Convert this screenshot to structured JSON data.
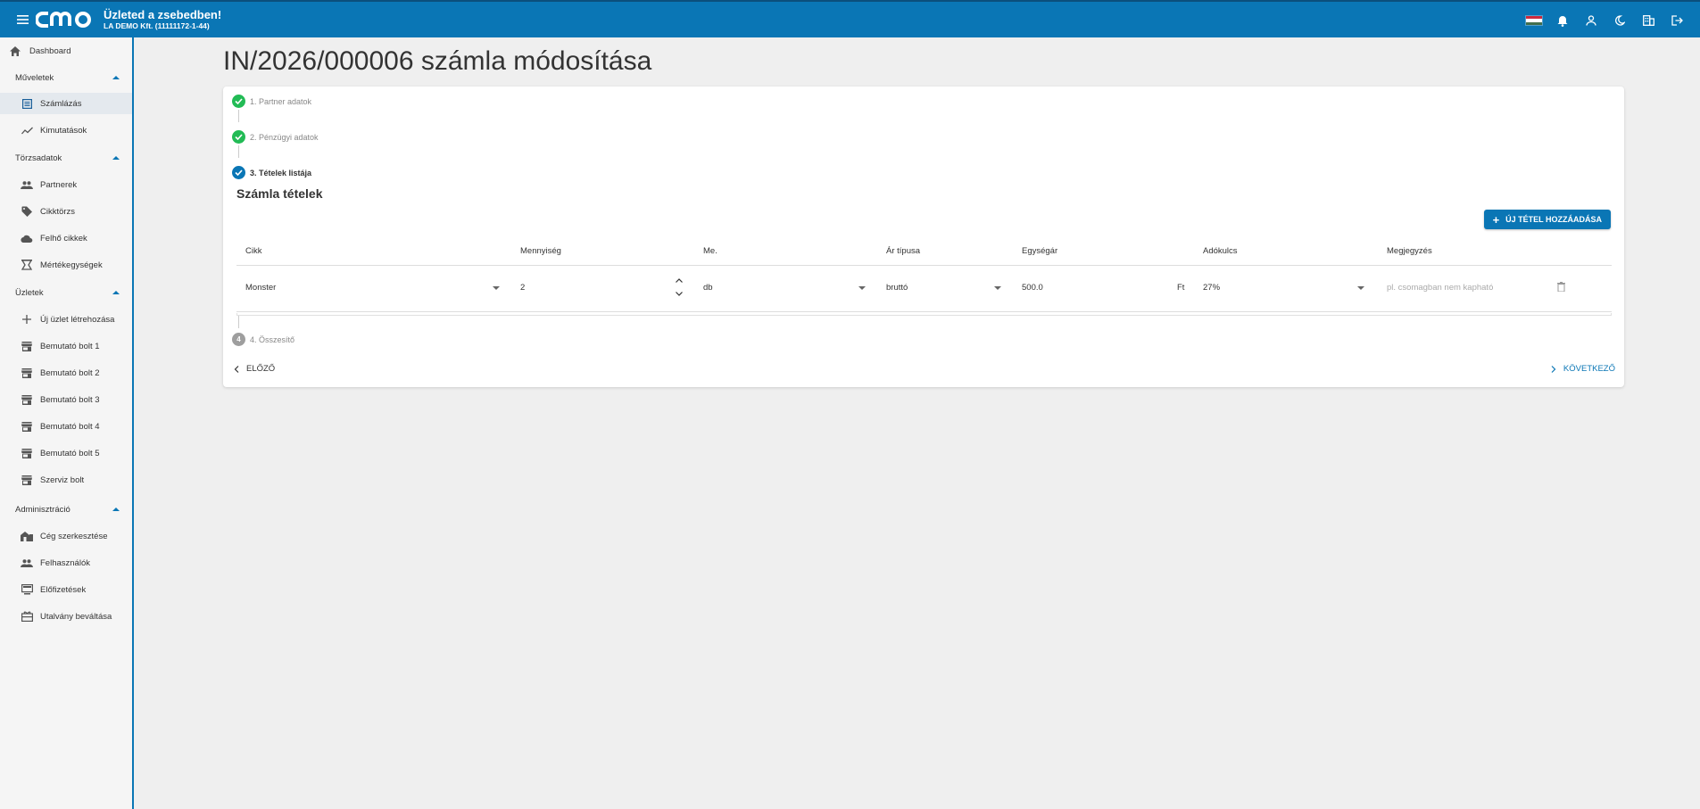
{
  "header": {
    "title": "Üzleted a zsebedben!",
    "company": "LA DEMO Kft. (11111172-1-44)",
    "logo_text": "cmo",
    "flag_colors": [
      "#cd2a3e",
      "#ffffff",
      "#436f4d"
    ]
  },
  "sidebar": {
    "dashboard": "Dashboard",
    "sections": [
      {
        "label": "Műveletek",
        "items": [
          {
            "label": "Számlázás",
            "icon": "list-icon",
            "active": true
          },
          {
            "label": "Kimutatások",
            "icon": "trending-icon"
          }
        ]
      },
      {
        "label": "Törzsadatok",
        "items": [
          {
            "label": "Partnerek",
            "icon": "people-icon"
          },
          {
            "label": "Cikktörzs",
            "icon": "tag-icon"
          },
          {
            "label": "Felhő cikkek",
            "icon": "cloud-icon"
          },
          {
            "label": "Mértékegységek",
            "icon": "scale-icon"
          }
        ]
      },
      {
        "label": "Üzletek",
        "items": [
          {
            "label": "Új üzlet létrehozása",
            "icon": "plus-icon"
          },
          {
            "label": "Bemutató bolt 1",
            "icon": "store-icon"
          },
          {
            "label": "Bemutató bolt 2",
            "icon": "store-icon"
          },
          {
            "label": "Bemutató bolt 3",
            "icon": "store-icon"
          },
          {
            "label": "Bemutató bolt 4",
            "icon": "store-icon"
          },
          {
            "label": "Bemutató bolt 5",
            "icon": "store-icon"
          },
          {
            "label": "Szerviz bolt",
            "icon": "store-icon"
          }
        ]
      },
      {
        "label": "Adminisztráció",
        "items": [
          {
            "label": "Cég szerkesztése",
            "icon": "company-icon"
          },
          {
            "label": "Felhasználók",
            "icon": "people-icon"
          },
          {
            "label": "Előfizetések",
            "icon": "subscription-icon"
          },
          {
            "label": "Utalvány beváltása",
            "icon": "voucher-icon"
          }
        ]
      }
    ]
  },
  "page": {
    "title": "IN/2026/000006 számla módosítása"
  },
  "stepper": {
    "steps": [
      {
        "label": "1. Partner adatok",
        "state": "done"
      },
      {
        "label": "2. Pénzügyi adatok",
        "state": "done"
      },
      {
        "label": "3. Tételek listája",
        "state": "current"
      },
      {
        "label": "4. Összesítő",
        "state": "pending",
        "number": "4"
      }
    ]
  },
  "items_section": {
    "title": "Számla tételek",
    "add_button": "ÚJ TÉTEL HOZZÁADÁSA",
    "columns": [
      "Cikk",
      "Mennyiség",
      "Me.",
      "Ár típusa",
      "Egységár",
      "Adókulcs",
      "Megjegyzés"
    ],
    "rows": [
      {
        "item": "Monster",
        "quantity": "2",
        "unit": "db",
        "price_type": "bruttó",
        "unit_price": "500.0",
        "currency": "Ft",
        "tax": "27%",
        "note_placeholder": "pl. csomagban nem kapható"
      }
    ]
  },
  "footer": {
    "prev": "ELŐZŐ",
    "next": "KÖVETKEZŐ"
  }
}
